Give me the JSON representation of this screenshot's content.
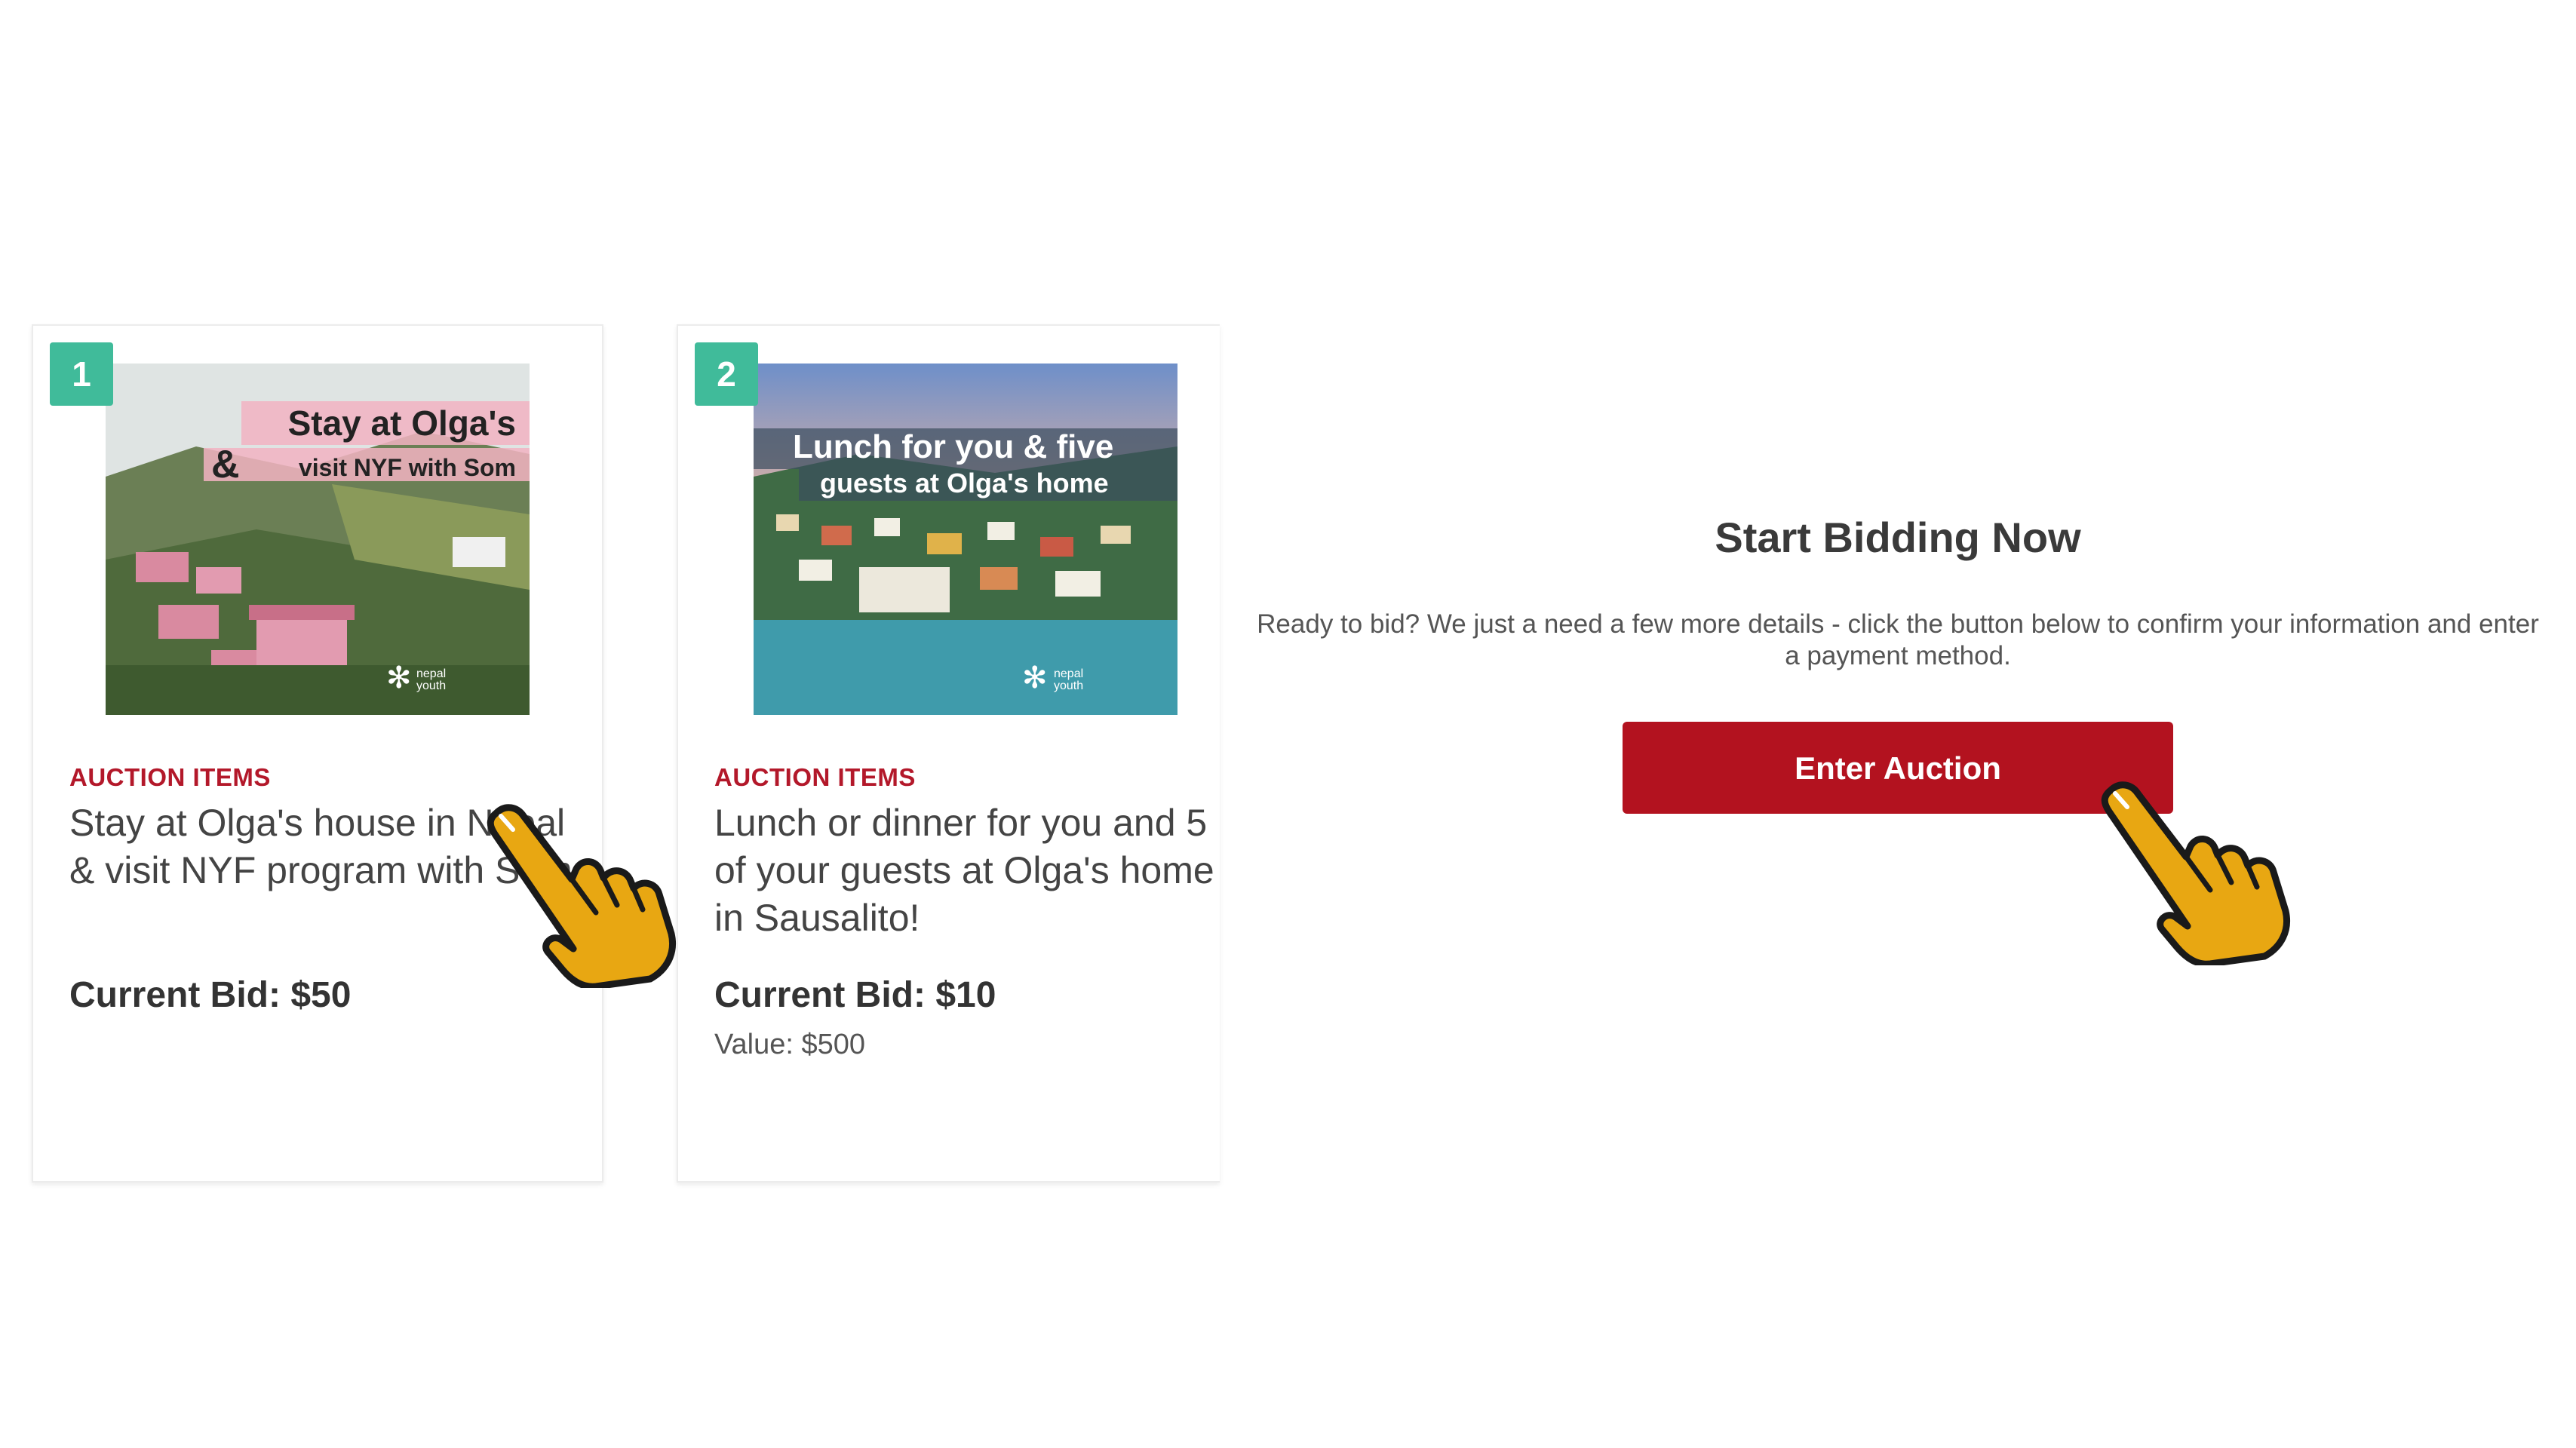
{
  "items": [
    {
      "number": "1",
      "category": "AUCTION ITEMS",
      "title": "Stay at Olga's house in Nepal & visit NYF program with Som",
      "current_bid": "Current Bid: $50",
      "image": {
        "line1": "Stay at Olga's",
        "amp": "&",
        "line2": "visit NYF with Som",
        "logo": "nepal youth"
      }
    },
    {
      "number": "2",
      "category": "AUCTION ITEMS",
      "title": "Lunch or dinner for you and 5 of your guests at Olga's home in Sausalito!",
      "current_bid": "Current Bid: $10",
      "value": "Value: $500",
      "image": {
        "line1": "Lunch for you & five",
        "line2": "guests at Olga's home",
        "logo": "nepal youth"
      }
    }
  ],
  "panel": {
    "heading": "Start Bidding Now",
    "description": "Ready to bid? We just a need a few more details - click the button below to confirm your information and enter a payment method.",
    "button_label": "Enter Auction"
  },
  "colors": {
    "badge": "#40bb9a",
    "category": "#b3182a",
    "button": "#b3121f",
    "hand": "#e8a712"
  },
  "icons": [
    "pointing-hand-icon",
    "snowflake-logo-icon"
  ]
}
